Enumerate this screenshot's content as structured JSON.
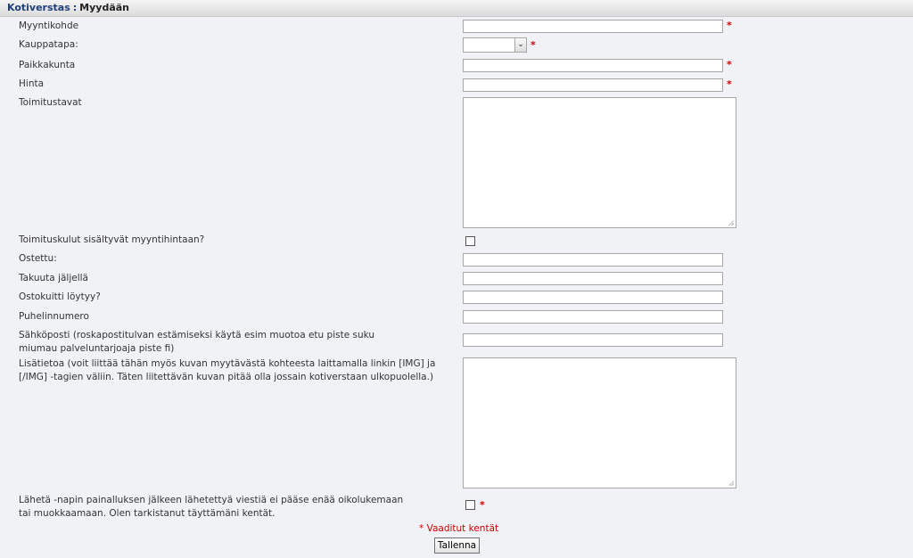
{
  "breadcrumb": {
    "section": "Kotiverstas",
    "separator": ":",
    "current": "Myydään"
  },
  "form": {
    "myyntikohde_label": "Myyntikohde",
    "kauppatapa_label": "Kauppatapa:",
    "kauppatapa_value": "",
    "paikkakunta_label": "Paikkakunta",
    "hinta_label": "Hinta",
    "toimitustavat_label": "Toimitustavat",
    "toimituskulut_label": "Toimituskulut sisältyvät myyntihintaan?",
    "ostettu_label": "Ostettu:",
    "takuuta_label": "Takuuta jäljellä",
    "ostokuitti_label": "Ostokuitti löytyy?",
    "puhelinnumero_label": "Puhelinnumero",
    "sahkoposti_label": "Sähköposti (roskapostitulvan estämiseksi käytä esim muotoa etu piste suku miumau palveluntarjoaja piste fi)",
    "lisatietoa_label": "Lisätietoa (voit liittää tähän myös kuvan myytävästä kohteesta laittamalla linkin [IMG] ja [/IMG] -tagien väliin. Täten liitettävän kuvan pitää olla jossain kotiverstaan ulkopuolella.)",
    "confirm_label": "Lähetä -napin painalluksen jälkeen lähetettyä viestiä ei pääse enää oikolukemaan tai muokkaamaan. Olen tarkistanut täyttämäni kentät.",
    "required_marker": "*",
    "required_note": "* Vaaditut kentät",
    "save_label": "Tallenna"
  },
  "icons": {
    "select_arrow": "chevron-down-icon",
    "resize": "resize-grip-icon"
  },
  "colors": {
    "required": "#cc0000",
    "breadcrumb_link": "#1f3f7a",
    "background": "#f0f2f5"
  }
}
